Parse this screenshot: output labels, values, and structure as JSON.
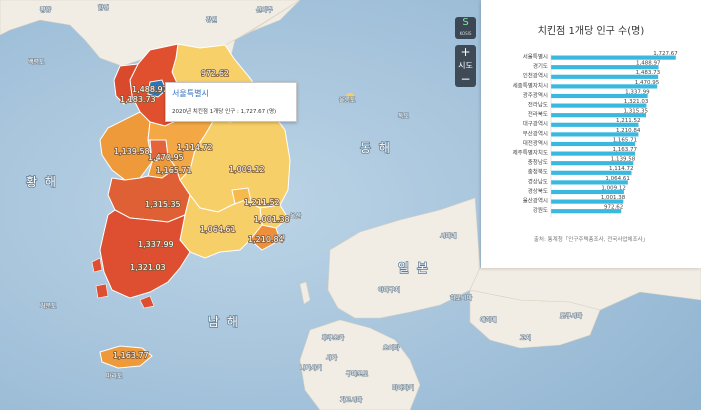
{
  "map": {
    "sea_labels": {
      "yellow_sea": "황 해",
      "east_sea": "동 해",
      "south_sea": "남 해"
    },
    "country_label": "일 본",
    "places": {
      "baengnyeong": "백령도",
      "ulleung": "울릉도",
      "dokdo": "독도",
      "geomundo": "거문도",
      "jeju": "마라도",
      "busan_en": "부산",
      "ulsan_en": "울산",
      "shimane": "시마네",
      "hiroshima": "히로시마",
      "yamaguchi": "야마구치",
      "fukuoka": "후쿠오카",
      "oita": "오이타",
      "ehime": "에히메",
      "tokushima": "도쿠시마",
      "kochi": "고치",
      "nagasaki": "나가사키",
      "saga": "사가",
      "kumamoto": "구마모토",
      "kagoshima": "가고시마",
      "miyazaki": "미야자키",
      "north1": "함경",
      "north2": "강원",
      "north3": "신의주",
      "north4": "평양"
    },
    "region_values": {
      "seoul": "1,727.67",
      "gyeonggi": "1,488.97",
      "incheon": "1,183.73",
      "gangwon": "972.62",
      "chungbuk": "1,114.72",
      "sejong": "1,470.95",
      "daejeon": "1,165.71",
      "chungnam": "1,139.58",
      "gyeongbuk": "1,009.12",
      "daegu": "1,211.52",
      "jeonbuk": "1,315.35",
      "gyeongnam": "1,064.61",
      "ulsan": "1,001.38",
      "busan": "1,210.84",
      "gwangju": "1,337.99",
      "jeonnam": "1,321.03",
      "jeju": "1,163.77"
    }
  },
  "zoom": {
    "logo_symbol": "S",
    "logo_text": "KOSIS",
    "zoom_in": "+",
    "level_label": "시도",
    "zoom_out": "−"
  },
  "tooltip": {
    "title": "서울특별시",
    "body": "2020년 치킨점 1개당 인구 : 1,727.67 (명)"
  },
  "panel": {
    "title": "치킨점 1개당 인구 수(명)",
    "source": "출처: 통계청「인구주택총조사, 전국사업체조사」"
  },
  "colors": {
    "bar": "#3bb8e0",
    "high": "#d9452b",
    "mid": "#ef9a3a",
    "low": "#f7cf68",
    "land": "#f0ece3",
    "sea": "#a8c6df"
  },
  "chart_data": {
    "type": "bar",
    "orientation": "horizontal",
    "title": "치킨점 1개당 인구 수(명)",
    "categories": [
      "서울특별시",
      "경기도",
      "인천광역시",
      "세종특별자치시",
      "광주광역시",
      "전라남도",
      "전라북도",
      "대구광역시",
      "부산광역시",
      "대전광역시",
      "제주특별자치도",
      "충청남도",
      "충청북도",
      "경상남도",
      "경상북도",
      "울산광역시",
      "강원도"
    ],
    "values": [
      1727.67,
      1488.97,
      1483.73,
      1470.95,
      1337.99,
      1321.03,
      1315.35,
      1211.52,
      1210.84,
      1165.71,
      1163.77,
      1139.58,
      1114.72,
      1064.61,
      1009.12,
      1001.38,
      972.62
    ],
    "value_labels": [
      "1,727.67",
      "1,488.97",
      "1,483.73",
      "1,470.95",
      "1,337.99",
      "1,321.03",
      "1,315.35",
      "1,211.52",
      "1,210.84",
      "1,165.71",
      "1,163.77",
      "1,139.58",
      "1,114.72",
      "1,064.61",
      "1,009.12",
      "1,001.38",
      "972.62"
    ],
    "xlim": [
      0,
      1800
    ],
    "grid": false,
    "bar_color": "#3bb8e0"
  }
}
